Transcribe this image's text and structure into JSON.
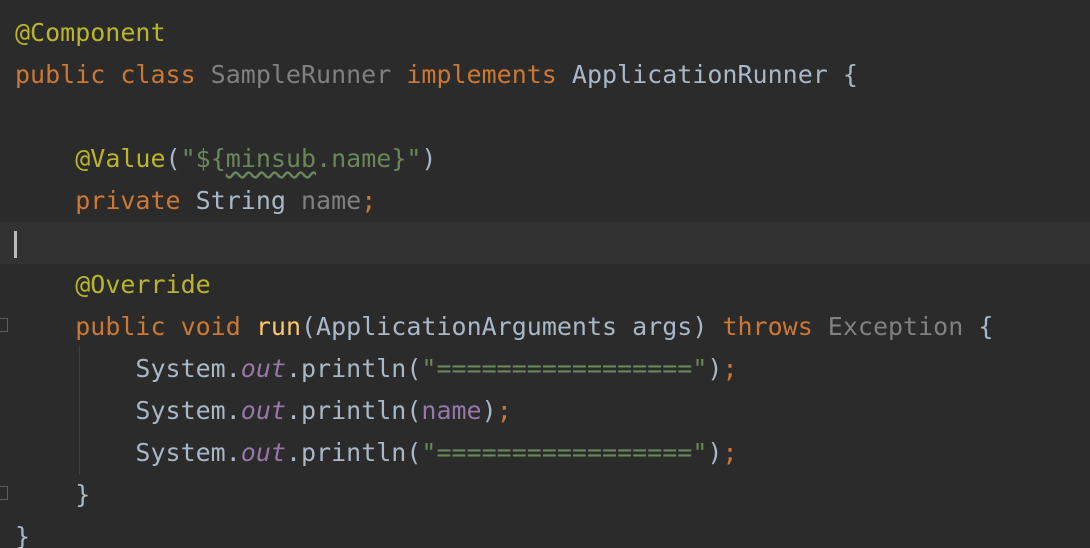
{
  "theme": {
    "background": "#2b2b2b",
    "current_line": "#323232",
    "colors": {
      "annotation": "#bbb529",
      "keyword": "#cc7832",
      "plain": "#a9b7c6",
      "unused": "#808080",
      "field": "#9876aa",
      "string": "#6a8759",
      "function": "#ffc66d"
    }
  },
  "editor": {
    "lines": [
      {
        "tokens": [
          {
            "t": "@Component",
            "c": "annotation"
          }
        ]
      },
      {
        "tokens": [
          {
            "t": "public ",
            "c": "keyword"
          },
          {
            "t": "class ",
            "c": "keyword"
          },
          {
            "t": "SampleRunner ",
            "c": "unused"
          },
          {
            "t": "implements ",
            "c": "keyword"
          },
          {
            "t": "ApplicationRunner {",
            "c": "plain"
          }
        ]
      },
      {
        "tokens": []
      },
      {
        "tokens": [
          {
            "t": "    ",
            "c": "plain"
          },
          {
            "t": "@Value",
            "c": "annotation"
          },
          {
            "t": "(",
            "c": "plain"
          },
          {
            "t": "\"${",
            "c": "string"
          },
          {
            "t": "minsub",
            "c": "string",
            "squiggle": true
          },
          {
            "t": ".name}\"",
            "c": "string"
          },
          {
            "t": ")",
            "c": "plain"
          }
        ]
      },
      {
        "tokens": [
          {
            "t": "    ",
            "c": "plain"
          },
          {
            "t": "private ",
            "c": "keyword"
          },
          {
            "t": "String ",
            "c": "plain"
          },
          {
            "t": "name",
            "c": "unused"
          },
          {
            "t": ";",
            "c": "keyword"
          }
        ]
      },
      {
        "tokens": [],
        "current": true
      },
      {
        "tokens": [
          {
            "t": "    ",
            "c": "plain"
          },
          {
            "t": "@Override",
            "c": "annotation"
          }
        ]
      },
      {
        "tokens": [
          {
            "t": "    ",
            "c": "plain"
          },
          {
            "t": "public ",
            "c": "keyword"
          },
          {
            "t": "void ",
            "c": "keyword"
          },
          {
            "t": "run",
            "c": "function"
          },
          {
            "t": "(ApplicationArguments args) ",
            "c": "plain"
          },
          {
            "t": "throws ",
            "c": "keyword"
          },
          {
            "t": "Exception ",
            "c": "unused"
          },
          {
            "t": "{",
            "c": "plain"
          }
        ]
      },
      {
        "tokens": [
          {
            "t": "        ",
            "c": "plain"
          },
          {
            "t": "System.",
            "c": "plain"
          },
          {
            "t": "out",
            "c": "field",
            "italic": true
          },
          {
            "t": ".println(",
            "c": "plain"
          },
          {
            "t": "\"=================\"",
            "c": "string"
          },
          {
            "t": ")",
            "c": "plain"
          },
          {
            "t": ";",
            "c": "keyword"
          }
        ]
      },
      {
        "tokens": [
          {
            "t": "        ",
            "c": "plain"
          },
          {
            "t": "System.",
            "c": "plain"
          },
          {
            "t": "out",
            "c": "field",
            "italic": true
          },
          {
            "t": ".println(",
            "c": "plain"
          },
          {
            "t": "name",
            "c": "field"
          },
          {
            "t": ")",
            "c": "plain"
          },
          {
            "t": ";",
            "c": "keyword"
          }
        ]
      },
      {
        "tokens": [
          {
            "t": "        ",
            "c": "plain"
          },
          {
            "t": "System.",
            "c": "plain"
          },
          {
            "t": "out",
            "c": "field",
            "italic": true
          },
          {
            "t": ".println(",
            "c": "plain"
          },
          {
            "t": "\"=================\"",
            "c": "string"
          },
          {
            "t": ")",
            "c": "plain"
          },
          {
            "t": ";",
            "c": "keyword"
          }
        ]
      },
      {
        "tokens": [
          {
            "t": "    ",
            "c": "plain"
          },
          {
            "t": "}",
            "c": "plain"
          }
        ]
      },
      {
        "tokens": [
          {
            "t": "}",
            "c": "plain"
          }
        ]
      }
    ]
  }
}
